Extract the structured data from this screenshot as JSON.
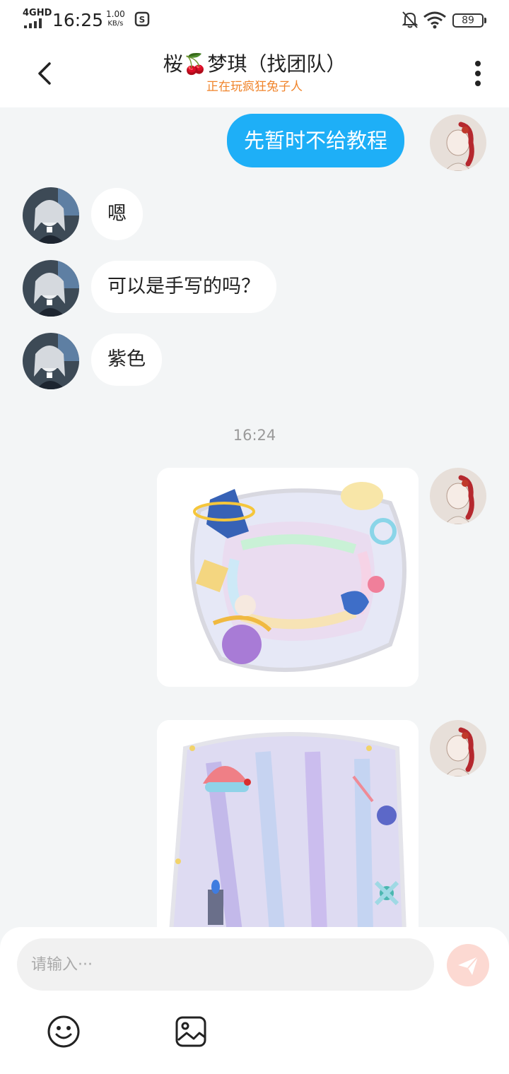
{
  "status_bar": {
    "network": "4GHD",
    "time": "16:25",
    "speed_value": "1.00",
    "speed_unit": "KB/s",
    "battery": "89"
  },
  "header": {
    "title": "桜🍒梦琪（找团队）",
    "subtitle": "正在玩疯狂兔子人"
  },
  "messages": [
    {
      "side": "right",
      "text": "先暂时不给教程"
    },
    {
      "side": "left",
      "text": "嗯"
    },
    {
      "side": "left",
      "text": "可以是手写的吗？"
    },
    {
      "side": "left",
      "text": "紫色"
    }
  ],
  "timestamp": "16:24",
  "images": [
    {
      "side": "right",
      "icon": "pastel-sticker-frame-image"
    },
    {
      "side": "right",
      "icon": "pastel-shell-fairy-image"
    }
  ],
  "composer": {
    "placeholder": "请输入···"
  },
  "colors": {
    "bubble_right": "#1eaff7",
    "bubble_left": "#ffffff",
    "subtitle": "#f0842b",
    "send_button": "#fcd9d2",
    "background": "#f3f5f6"
  }
}
